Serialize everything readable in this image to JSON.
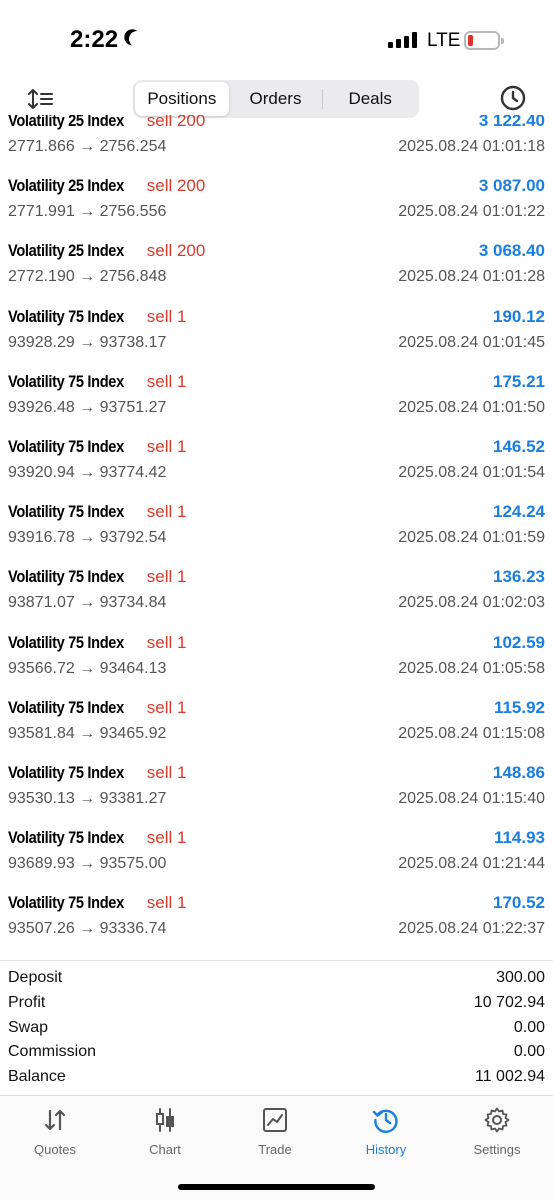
{
  "status": {
    "time": "2:22",
    "network": "LTE"
  },
  "header": {
    "tabs": [
      {
        "label": "Positions",
        "active": true
      },
      {
        "label": "Orders",
        "active": false
      },
      {
        "label": "Deals",
        "active": false
      }
    ],
    "left_icon": "sort-icon",
    "right_icon": "clock-icon"
  },
  "deals": [
    {
      "symbol": "Volatility 25 Index",
      "side": "sell 200",
      "profit": "3 122.40",
      "prices": "2771.866 → 2756.254",
      "time": "2025.08.24 01:01:18"
    },
    {
      "symbol": "Volatility 25 Index",
      "side": "sell 200",
      "profit": "3 087.00",
      "prices": "2771.991 → 2756.556",
      "time": "2025.08.24 01:01:22"
    },
    {
      "symbol": "Volatility 25 Index",
      "side": "sell 200",
      "profit": "3 068.40",
      "prices": "2772.190 → 2756.848",
      "time": "2025.08.24 01:01:28"
    },
    {
      "symbol": "Volatility 75 Index",
      "side": "sell 1",
      "profit": "190.12",
      "prices": "93928.29 → 93738.17",
      "time": "2025.08.24 01:01:45"
    },
    {
      "symbol": "Volatility 75 Index",
      "side": "sell 1",
      "profit": "175.21",
      "prices": "93926.48 → 93751.27",
      "time": "2025.08.24 01:01:50"
    },
    {
      "symbol": "Volatility 75 Index",
      "side": "sell 1",
      "profit": "146.52",
      "prices": "93920.94 → 93774.42",
      "time": "2025.08.24 01:01:54"
    },
    {
      "symbol": "Volatility 75 Index",
      "side": "sell 1",
      "profit": "124.24",
      "prices": "93916.78 → 93792.54",
      "time": "2025.08.24 01:01:59"
    },
    {
      "symbol": "Volatility 75 Index",
      "side": "sell 1",
      "profit": "136.23",
      "prices": "93871.07 → 93734.84",
      "time": "2025.08.24 01:02:03"
    },
    {
      "symbol": "Volatility 75 Index",
      "side": "sell 1",
      "profit": "102.59",
      "prices": "93566.72 → 93464.13",
      "time": "2025.08.24 01:05:58"
    },
    {
      "symbol": "Volatility 75 Index",
      "side": "sell 1",
      "profit": "115.92",
      "prices": "93581.84 → 93465.92",
      "time": "2025.08.24 01:15:08"
    },
    {
      "symbol": "Volatility 75 Index",
      "side": "sell 1",
      "profit": "148.86",
      "prices": "93530.13 → 93381.27",
      "time": "2025.08.24 01:15:40"
    },
    {
      "symbol": "Volatility 75 Index",
      "side": "sell 1",
      "profit": "114.93",
      "prices": "93689.93 → 93575.00",
      "time": "2025.08.24 01:21:44"
    },
    {
      "symbol": "Volatility 75 Index",
      "side": "sell 1",
      "profit": "170.52",
      "prices": "93507.26 → 93336.74",
      "time": "2025.08.24 01:22:37"
    }
  ],
  "summary": [
    {
      "label": "Deposit",
      "value": "300.00"
    },
    {
      "label": "Profit",
      "value": "10 702.94"
    },
    {
      "label": "Swap",
      "value": "0.00"
    },
    {
      "label": "Commission",
      "value": "0.00"
    },
    {
      "label": "Balance",
      "value": "11 002.94"
    }
  ],
  "tab_bar": [
    {
      "label": "Quotes",
      "icon": "quotes-arrows-icon",
      "active": false
    },
    {
      "label": "Chart",
      "icon": "candlestick-icon",
      "active": false
    },
    {
      "label": "Trade",
      "icon": "trade-chart-icon",
      "active": false
    },
    {
      "label": "History",
      "icon": "history-clock-icon",
      "active": true
    },
    {
      "label": "Settings",
      "icon": "gear-icon",
      "active": false
    }
  ],
  "colors": {
    "accent": "#1a7fe0",
    "sell": "#d93b2b",
    "battery_low": "#e0312b"
  }
}
